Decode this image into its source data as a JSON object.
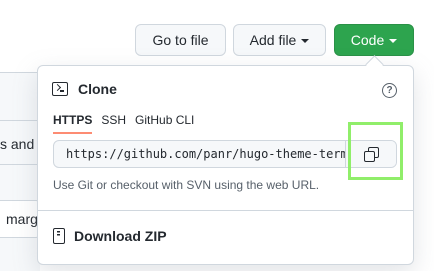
{
  "toolbar": {
    "goto_label": "Go to file",
    "add_label": "Add file",
    "code_label": "Code"
  },
  "background": {
    "frag_1": "s and",
    "frag_2": "marg"
  },
  "clone_panel": {
    "title": "Clone",
    "help_symbol": "?",
    "tabs": [
      "HTTPS",
      "SSH",
      "GitHub CLI"
    ],
    "active_tab": "HTTPS",
    "url_value": "https://github.com/panr/hugo-theme-terminal.git",
    "hint": "Use Git or checkout with SVN using the web URL.",
    "download_label": "Download ZIP"
  },
  "colors": {
    "code_button": "#2da44e",
    "tab_underline": "#fd8c73",
    "highlight_box": "#90ee6a"
  },
  "icons": [
    "caret-down-icon",
    "terminal-icon",
    "question-icon",
    "copy-icon",
    "file-zip-icon"
  ]
}
